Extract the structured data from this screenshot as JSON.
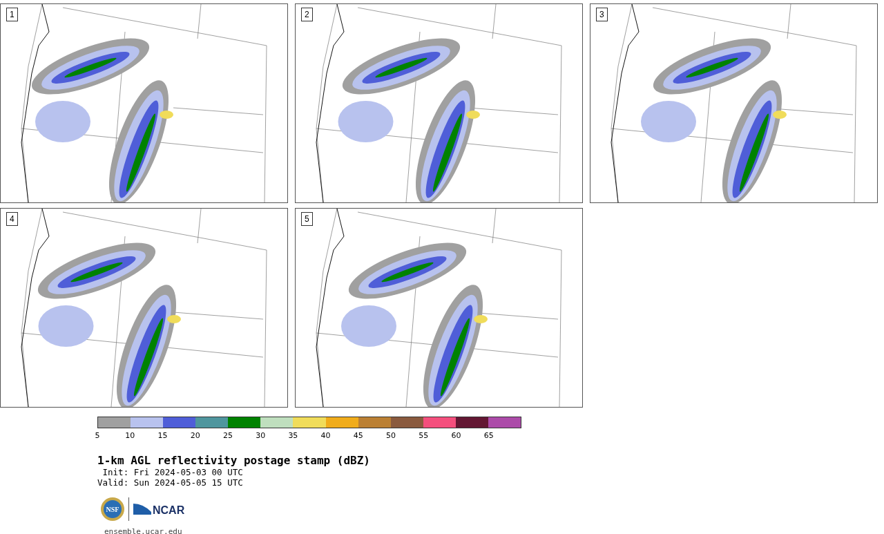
{
  "panels": [
    {
      "number": "1"
    },
    {
      "number": "2"
    },
    {
      "number": "3"
    },
    {
      "number": "4"
    },
    {
      "number": "5"
    }
  ],
  "colorbar": {
    "bins": [
      {
        "color": "#a0a0a0"
      },
      {
        "color": "#b8c2ee"
      },
      {
        "color": "#4f5ed8"
      },
      {
        "color": "#4f969e"
      },
      {
        "color": "#008200"
      },
      {
        "color": "#bfdfbe"
      },
      {
        "color": "#f0dc5a"
      },
      {
        "color": "#f0ac1b"
      },
      {
        "color": "#bb8034"
      },
      {
        "color": "#8a5a3e"
      },
      {
        "color": "#f44f7d"
      },
      {
        "color": "#631733"
      },
      {
        "color": "#ac4ba9"
      }
    ],
    "ticks": [
      "5",
      "10",
      "15",
      "20",
      "25",
      "30",
      "35",
      "40",
      "45",
      "50",
      "55",
      "60",
      "65"
    ]
  },
  "title": "1-km AGL reflectivity postage stamp (dBZ)",
  "init": " Init: Fri 2024-05-03 00 UTC",
  "valid": "Valid: Sun 2024-05-05 15 UTC",
  "logos": {
    "nsf": "NSF",
    "ncar": "NCAR"
  },
  "footer": "ensemble.ucar.edu"
}
